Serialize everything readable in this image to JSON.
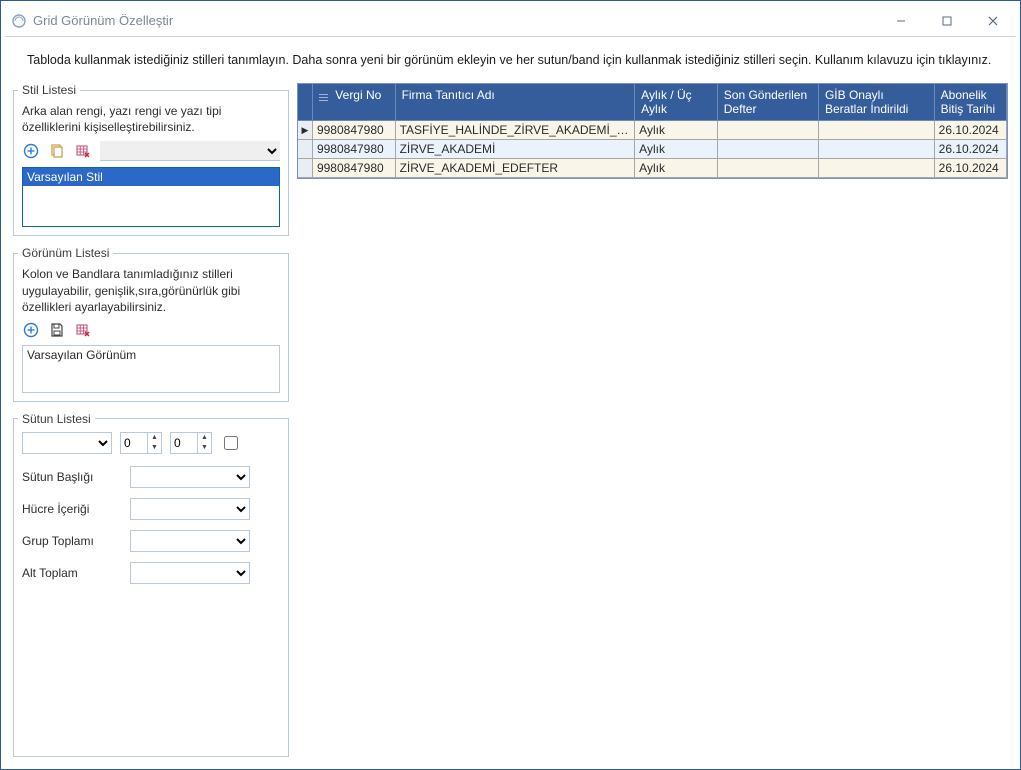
{
  "window": {
    "title": "Grid Görünüm Özelleştir"
  },
  "instruction": "Tabloda kullanmak istediğiniz stilleri tanımlayın. Daha sonra  yeni bir görünüm ekleyin ve her sutun/band için kullanmak istediğiniz stilleri seçin. Kullanım kılavuzu için tıklayınız.",
  "stylePanel": {
    "legend": "Stil Listesi",
    "desc": "Arka alan rengi, yazı rengi ve yazı tipi özelliklerini kişiselleştirebilirsiniz.",
    "items": {
      "0": "Varsayılan Stil"
    }
  },
  "viewPanel": {
    "legend": "Görünüm Listesi",
    "desc": "Kolon ve Bandlara tanımladığınız stilleri uygulayabilir, genişlik,sıra,görünürlük gibi özellikleri ayarlayabilirsiniz.",
    "items": {
      "0": "Varsayılan Görünüm"
    }
  },
  "columnPanel": {
    "legend": "Sütun Listesi",
    "spin1": "0",
    "spin2": "0",
    "labels": {
      "header": "Sütun Başlığı",
      "cell": "Hücre İçeriği",
      "groupTotal": "Grup Toplamı",
      "subTotal": "Alt Toplam"
    }
  },
  "grid": {
    "columns": {
      "vergiNo": "Vergi No",
      "firma": "Firma Tanıtıcı Adı",
      "aylik": "Aylık / Üç Aylık",
      "sonDefter": "Son Gönderilen Defter",
      "gib": "GİB Onaylı Beratlar İndirildi",
      "abonelik": "Abonelik Bitiş Tarihi"
    },
    "rows": {
      "0": {
        "vergiNo": "9980847980",
        "firma": "TASFİYE_HALİNDE_ZİRVE_AKADEMİ_EDEFTER",
        "aylik": "Aylık",
        "sonDefter": "",
        "gib": "",
        "abonelik": "26.10.2024"
      },
      "1": {
        "vergiNo": "9980847980",
        "firma": "ZİRVE_AKADEMİ",
        "aylik": "Aylık",
        "sonDefter": "",
        "gib": "",
        "abonelik": "26.10.2024"
      },
      "2": {
        "vergiNo": "9980847980",
        "firma": "ZİRVE_AKADEMİ_EDEFTER",
        "aylik": "Aylık",
        "sonDefter": "",
        "gib": "",
        "abonelik": "26.10.2024"
      }
    }
  }
}
